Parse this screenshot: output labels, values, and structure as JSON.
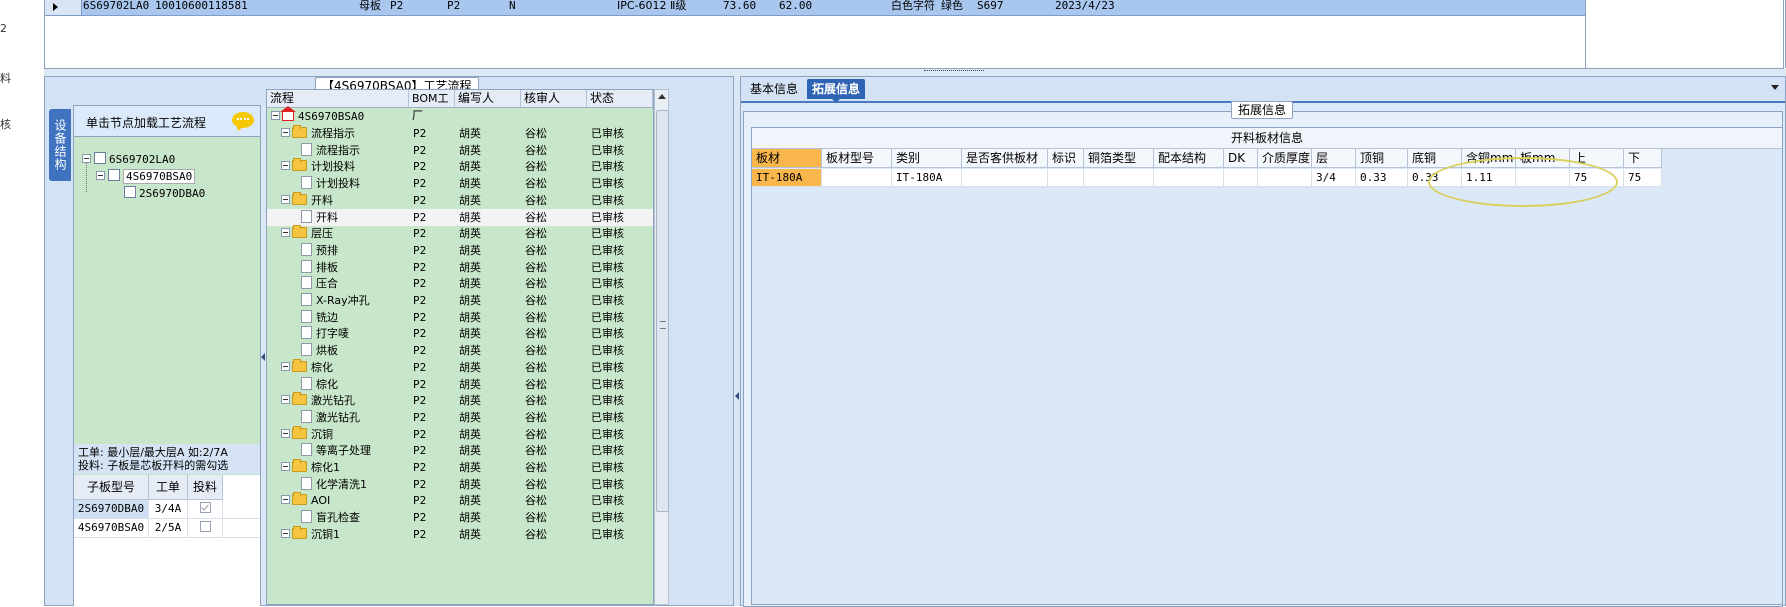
{
  "left_edge_labels": [
    "2",
    "料",
    "核"
  ],
  "top_row": {
    "cells": [
      "6S69702LA0",
      "10010600118581",
      "母板",
      "P2",
      "P2",
      "N",
      "IPC-6012 Ⅱ级",
      "73.60",
      "62.00",
      "白色字符",
      "绿色",
      "S697",
      "2023/4/23"
    ]
  },
  "process_title": "【4S6970BSA0】工艺流程",
  "side_tab": "设备结构",
  "structure": {
    "hint": "单击节点加载工艺流程",
    "nodes": [
      "6S69702LA0",
      "4S6970BSA0",
      "2S6970DBA0"
    ],
    "note_line1": "工单: 最小层/最大层A 如:2/7A",
    "note_line2": "投料: 子板是芯板开料的需勾选",
    "sub_table": {
      "headers": [
        "子板型号",
        "工单",
        "投料"
      ],
      "rows": [
        {
          "model": "2S6970DBA0",
          "order": "3/4A",
          "checked": true
        },
        {
          "model": "4S6970BSA0",
          "order": "2/5A",
          "checked": false
        }
      ]
    }
  },
  "process_grid": {
    "headers": [
      "流程",
      "BOM工厂",
      "编写人",
      "核审人",
      "状态"
    ],
    "root": "4S6970BSA0",
    "rows": [
      {
        "level": 1,
        "type": "folder",
        "name": "流程指示",
        "factory": "P2",
        "writer": "胡英",
        "reviewer": "谷松",
        "status": "已审核"
      },
      {
        "level": 2,
        "type": "doc",
        "name": "流程指示",
        "factory": "P2",
        "writer": "胡英",
        "reviewer": "谷松",
        "status": "已审核"
      },
      {
        "level": 1,
        "type": "folder",
        "name": "计划投料",
        "factory": "P2",
        "writer": "胡英",
        "reviewer": "谷松",
        "status": "已审核"
      },
      {
        "level": 2,
        "type": "doc",
        "name": "计划投料",
        "factory": "P2",
        "writer": "胡英",
        "reviewer": "谷松",
        "status": "已审核"
      },
      {
        "level": 1,
        "type": "folder",
        "name": "开料",
        "factory": "P2",
        "writer": "胡英",
        "reviewer": "谷松",
        "status": "已审核"
      },
      {
        "level": 2,
        "type": "doc",
        "name": "开料",
        "factory": "P2",
        "writer": "胡英",
        "reviewer": "谷松",
        "status": "已审核",
        "selected": true
      },
      {
        "level": 1,
        "type": "folder",
        "name": "层压",
        "factory": "P2",
        "writer": "胡英",
        "reviewer": "谷松",
        "status": "已审核"
      },
      {
        "level": 2,
        "type": "doc",
        "name": "预排",
        "factory": "P2",
        "writer": "胡英",
        "reviewer": "谷松",
        "status": "已审核"
      },
      {
        "level": 2,
        "type": "doc",
        "name": "排板",
        "factory": "P2",
        "writer": "胡英",
        "reviewer": "谷松",
        "status": "已审核"
      },
      {
        "level": 2,
        "type": "doc",
        "name": "压合",
        "factory": "P2",
        "writer": "胡英",
        "reviewer": "谷松",
        "status": "已审核"
      },
      {
        "level": 2,
        "type": "doc",
        "name": "X-Ray冲孔",
        "factory": "P2",
        "writer": "胡英",
        "reviewer": "谷松",
        "status": "已审核"
      },
      {
        "level": 2,
        "type": "doc",
        "name": "铣边",
        "factory": "P2",
        "writer": "胡英",
        "reviewer": "谷松",
        "status": "已审核"
      },
      {
        "level": 2,
        "type": "doc",
        "name": "打字唛",
        "factory": "P2",
        "writer": "胡英",
        "reviewer": "谷松",
        "status": "已审核"
      },
      {
        "level": 2,
        "type": "doc",
        "name": "烘板",
        "factory": "P2",
        "writer": "胡英",
        "reviewer": "谷松",
        "status": "已审核"
      },
      {
        "level": 1,
        "type": "folder",
        "name": "棕化",
        "factory": "P2",
        "writer": "胡英",
        "reviewer": "谷松",
        "status": "已审核"
      },
      {
        "level": 2,
        "type": "doc",
        "name": "棕化",
        "factory": "P2",
        "writer": "胡英",
        "reviewer": "谷松",
        "status": "已审核"
      },
      {
        "level": 1,
        "type": "folder",
        "name": "激光钻孔",
        "factory": "P2",
        "writer": "胡英",
        "reviewer": "谷松",
        "status": "已审核"
      },
      {
        "level": 2,
        "type": "doc",
        "name": "激光钻孔",
        "factory": "P2",
        "writer": "胡英",
        "reviewer": "谷松",
        "status": "已审核"
      },
      {
        "level": 1,
        "type": "folder",
        "name": "沉铜",
        "factory": "P2",
        "writer": "胡英",
        "reviewer": "谷松",
        "status": "已审核"
      },
      {
        "level": 2,
        "type": "doc",
        "name": "等离子处理",
        "factory": "P2",
        "writer": "胡英",
        "reviewer": "谷松",
        "status": "已审核"
      },
      {
        "level": 1,
        "type": "folder",
        "name": "棕化1",
        "factory": "P2",
        "writer": "胡英",
        "reviewer": "谷松",
        "status": "已审核"
      },
      {
        "level": 2,
        "type": "doc",
        "name": "化学清洗1",
        "factory": "P2",
        "writer": "胡英",
        "reviewer": "谷松",
        "status": "已审核"
      },
      {
        "level": 1,
        "type": "folder",
        "name": "AOI",
        "factory": "P2",
        "writer": "胡英",
        "reviewer": "谷松",
        "status": "已审核"
      },
      {
        "level": 2,
        "type": "doc",
        "name": "盲孔检查",
        "factory": "P2",
        "writer": "胡英",
        "reviewer": "谷松",
        "status": "已审核"
      },
      {
        "level": 1,
        "type": "folder",
        "name": "沉铜1",
        "factory": "P2",
        "writer": "胡英",
        "reviewer": "谷松",
        "status": "已审核"
      }
    ]
  },
  "right": {
    "tabs": [
      "基本信息",
      "拓展信息"
    ],
    "active_tab": "拓展信息",
    "group_title": "拓展信息",
    "grid_caption": "开料板材信息",
    "headers": [
      "板材",
      "板材型号",
      "类别",
      "是否客供板材",
      "标识",
      "铜箔类型",
      "配本结构",
      "DK值",
      "介质厚度",
      "层",
      "顶铜",
      "底铜",
      "含铜mm",
      "板mm",
      "上",
      "下"
    ],
    "row": [
      "IT-180A",
      "",
      "IT-180A",
      "",
      "",
      "",
      "",
      "",
      "",
      "3/4",
      "0.33",
      "0.33",
      "1.11",
      "",
      "75",
      "75"
    ]
  },
  "colors": {
    "accent_blue": "#2f63b3",
    "tree_green": "#c8e6c9",
    "selected_cell": "#f8b64c",
    "highlight_ellipse": "#d8d05a"
  }
}
